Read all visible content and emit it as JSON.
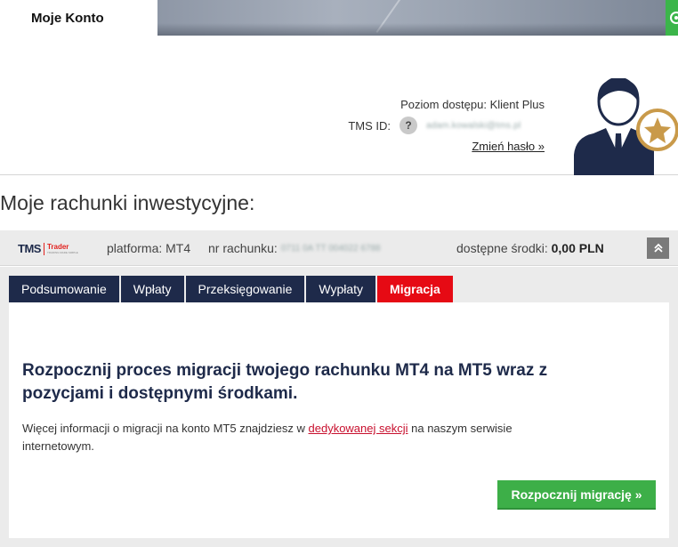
{
  "header": {
    "title": "Moje Konto"
  },
  "profile": {
    "access_label": "Poziom dostępu: Klient Plus",
    "tms_id_label": "TMS ID:",
    "tms_id_help": "?",
    "tms_id_value": "adam.kowalski@tms.pl",
    "change_password": "Zmień hasło »"
  },
  "section": {
    "title": "Moje rachunki inwestycyjne:"
  },
  "account": {
    "logo_tms": "TMS",
    "logo_trader": "Trader",
    "logo_tagline": "TRADING MADE SIMPLE",
    "platform": "platforma: MT4",
    "account_number_label": "nr rachunku:",
    "account_number_value": "0711 0A TT 004022 6788",
    "funds_label": "dostępne środki:",
    "funds_value": "0,00 PLN"
  },
  "tabs": [
    {
      "label": "Podsumowanie"
    },
    {
      "label": "Wpłaty"
    },
    {
      "label": "Przeksięgowanie"
    },
    {
      "label": "Wypłaty"
    },
    {
      "label": "Migracja"
    }
  ],
  "migration": {
    "heading": "Rozpocznij proces migracji twojego rachunku MT4 na MT5 wraz z pozycjami i dostępnymi środkami.",
    "info_before": "Więcej informacji o migracji na konto MT5 znajdziesz w ",
    "info_link": "dedykowanej sekcji",
    "info_after": " na naszym serwisie internetowym.",
    "button": "Rozpocznij migrację »"
  },
  "colors": {
    "navy": "#1e2a4a",
    "active_tab": "#e60a14",
    "green": "#3daf48",
    "link_red": "#c8102e",
    "avatar_gold": "#c99a4a"
  }
}
